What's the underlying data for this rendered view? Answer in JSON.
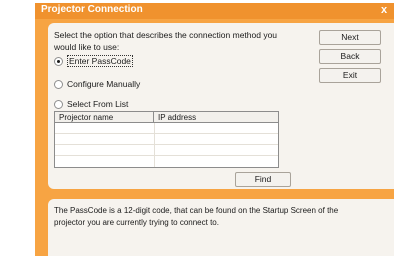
{
  "window": {
    "title": "Projector Connection",
    "close_glyph": "x"
  },
  "prompt": "Select the option that describes the connection method you would like to use:",
  "options": [
    {
      "label": "Enter PassCode",
      "selected": true
    },
    {
      "label": "Configure Manually",
      "selected": false
    },
    {
      "label": "Select From List",
      "selected": false
    }
  ],
  "buttons": {
    "next": "Next",
    "back": "Back",
    "exit": "Exit",
    "find": "Find"
  },
  "table": {
    "columns": [
      "Projector name",
      "IP address"
    ],
    "rows": []
  },
  "info": "The PassCode is a 12-digit code, that can be found on the Startup Screen of the projector you are currently trying to connect to.",
  "colors": {
    "frame": "#f7a443",
    "titlebar": "#f0922e",
    "panel": "#f6f3ee"
  }
}
